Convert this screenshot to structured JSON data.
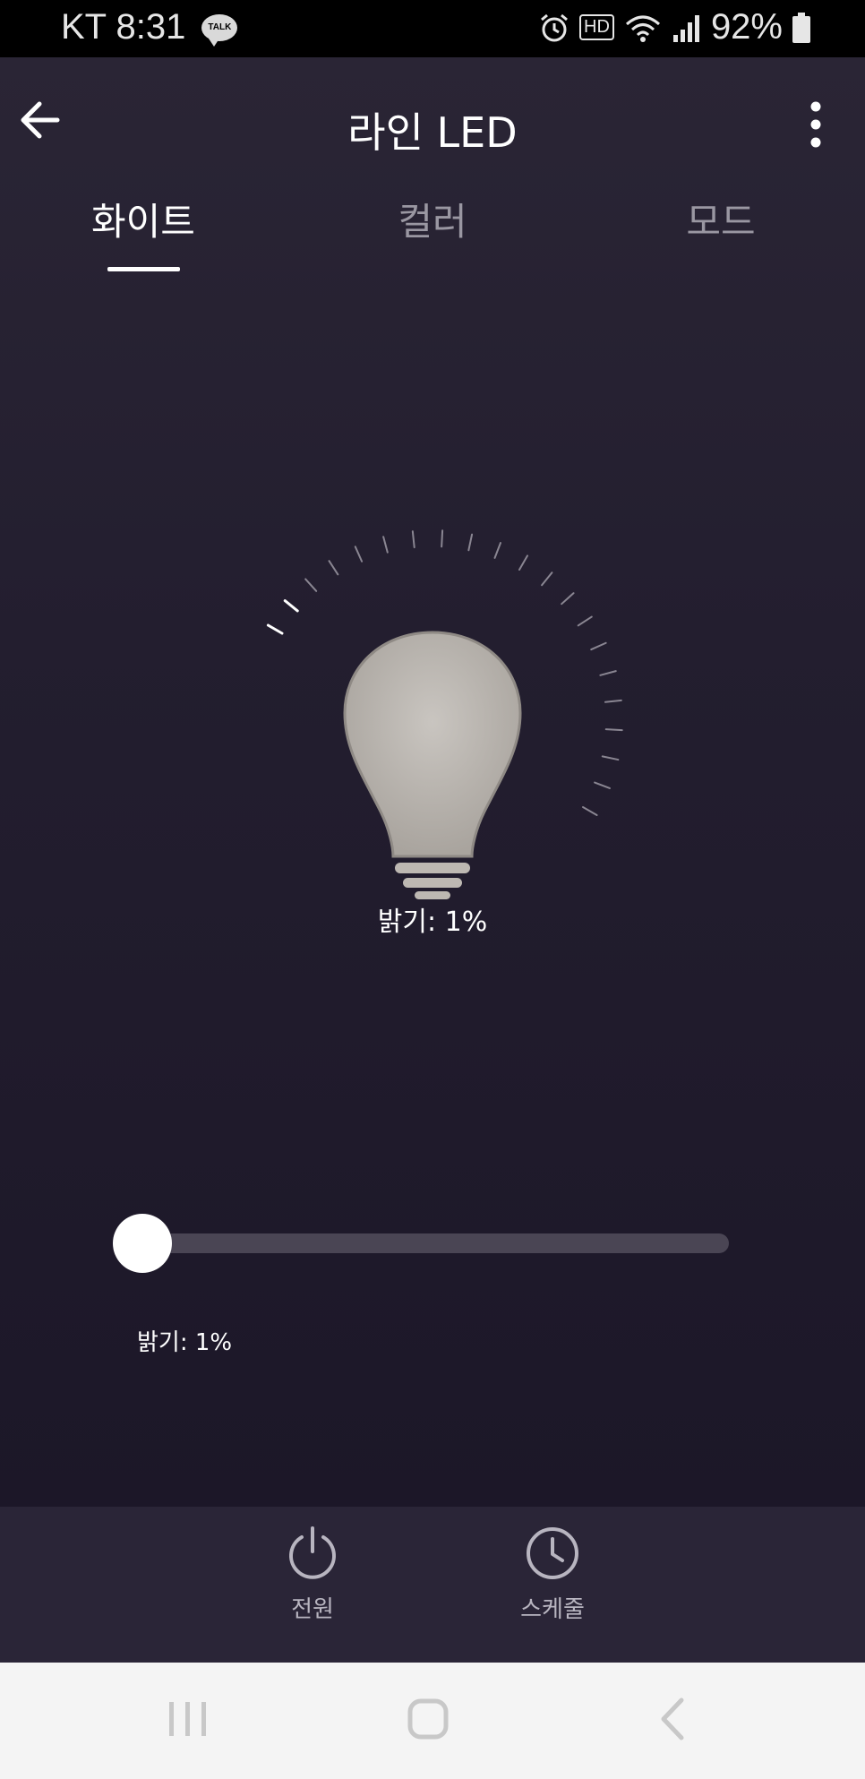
{
  "status_bar": {
    "carrier_time": "KT 8:31",
    "talk_icon_label": "TALK",
    "hd_label": "HD",
    "battery": "92%"
  },
  "header": {
    "title": "라인 LED"
  },
  "tabs": [
    {
      "label": "화이트",
      "active": true
    },
    {
      "label": "컬러",
      "active": false
    },
    {
      "label": "모드",
      "active": false
    }
  ],
  "bulb": {
    "brightness_text": "밝기: 1%"
  },
  "slider": {
    "value_percent": 1,
    "label": "밝기: 1%"
  },
  "actions": {
    "power_label": "전원",
    "schedule_label": "스케줄"
  },
  "colors": {
    "accent": "#ffffff",
    "bulb_fill": "#bdb8b2",
    "track": "#4a4554"
  }
}
